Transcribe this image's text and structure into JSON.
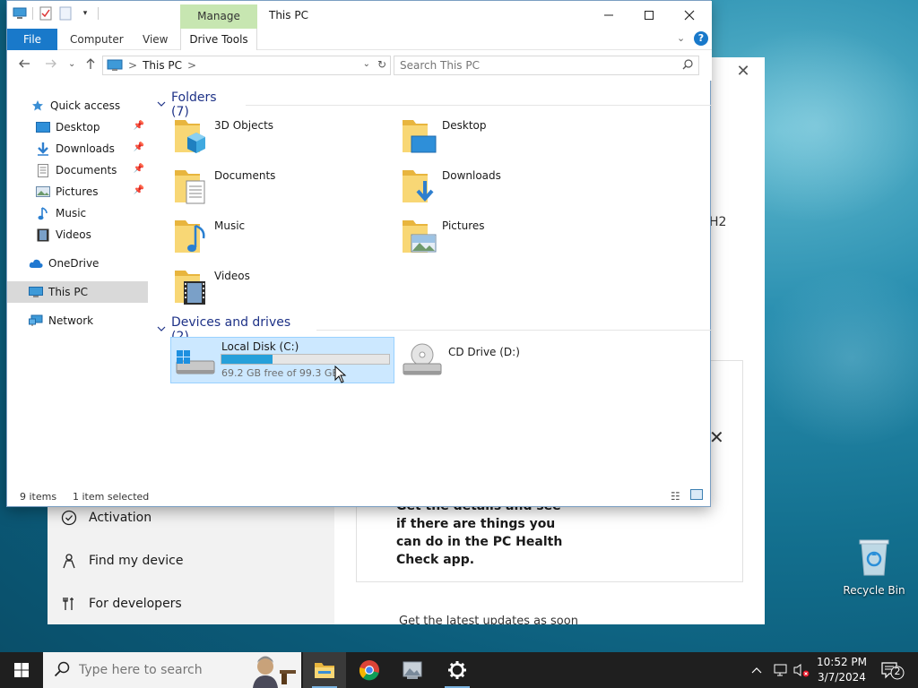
{
  "explorer": {
    "title": "This PC",
    "manage_tab": "Manage",
    "ribbon": {
      "file": "File",
      "computer": "Computer",
      "view": "View",
      "drive_tools": "Drive Tools"
    },
    "address": {
      "crumb": "This PC",
      "sep": ">"
    },
    "search": {
      "placeholder": "Search This PC"
    },
    "nav": [
      {
        "label": "Quick access",
        "icon": "star-icon"
      },
      {
        "label": "Desktop",
        "icon": "desktop-icon",
        "pinned": true
      },
      {
        "label": "Downloads",
        "icon": "download-icon",
        "pinned": true
      },
      {
        "label": "Documents",
        "icon": "document-icon",
        "pinned": true
      },
      {
        "label": "Pictures",
        "icon": "pictures-icon",
        "pinned": true
      },
      {
        "label": "Music",
        "icon": "music-icon"
      },
      {
        "label": "Videos",
        "icon": "video-icon"
      },
      {
        "label": "OneDrive",
        "icon": "cloud-icon"
      },
      {
        "label": "This PC",
        "icon": "computer-icon",
        "selected": true
      },
      {
        "label": "Network",
        "icon": "network-icon"
      }
    ],
    "folders_header": "Folders (7)",
    "folders": [
      {
        "label": "3D Objects"
      },
      {
        "label": "Desktop"
      },
      {
        "label": "Documents"
      },
      {
        "label": "Downloads"
      },
      {
        "label": "Music"
      },
      {
        "label": "Pictures"
      },
      {
        "label": "Videos"
      }
    ],
    "devices_header": "Devices and drives (2)",
    "drives": [
      {
        "label": "Local Disk (C:)",
        "free": "69.2 GB free of 99.3 GB",
        "used_fraction": 0.303
      },
      {
        "label": "CD Drive (D:)"
      }
    ],
    "status": {
      "items": "9 items",
      "selected": "1 item selected"
    }
  },
  "settings": {
    "nav": [
      {
        "label": "Activation",
        "icon": "check-circle-icon"
      },
      {
        "label": "Find my device",
        "icon": "person-icon"
      },
      {
        "label": "For developers",
        "icon": "tools-icon"
      }
    ],
    "partial_version": "H2",
    "card_text": "Get the details and see if there are things you can do in the PC Health Check app.",
    "bottom_text": "Get the latest updates as soon"
  },
  "desktop": {
    "recycle_bin": "Recycle Bin"
  },
  "taskbar": {
    "search_placeholder": "Type here to search",
    "time": "10:52 PM",
    "date": "3/7/2024",
    "notification_count": "2"
  },
  "colors": {
    "accent": "#1979ca",
    "manage_tab": "#c7e6b1",
    "selection": "#cce8ff",
    "drive_bar": "#26a0da",
    "group_header": "#1e3287"
  }
}
